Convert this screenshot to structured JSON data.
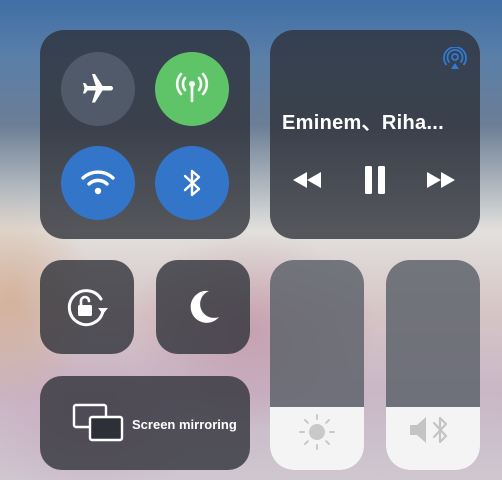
{
  "media": {
    "title": "Eminem、Riha..."
  },
  "tiles": {
    "screen_mirroring_label": "Screen mirroring"
  },
  "sliders": {
    "brightness_level": 0.3,
    "volume_level": 0.3
  },
  "colors": {
    "cellular_active": "#5fc468",
    "wifi_active": "#3275c9",
    "bluetooth_active": "#3275c9",
    "airplay_accent": "#2f7bd8"
  },
  "icons": [
    "airplane-icon",
    "cellular-antenna-icon",
    "wifi-icon",
    "bluetooth-icon",
    "airplay-audio-icon",
    "rewind-icon",
    "pause-icon",
    "fast-forward-icon",
    "rotation-lock-icon",
    "moon-icon",
    "screen-mirroring-icon",
    "brightness-sun-icon",
    "speaker-icon"
  ]
}
